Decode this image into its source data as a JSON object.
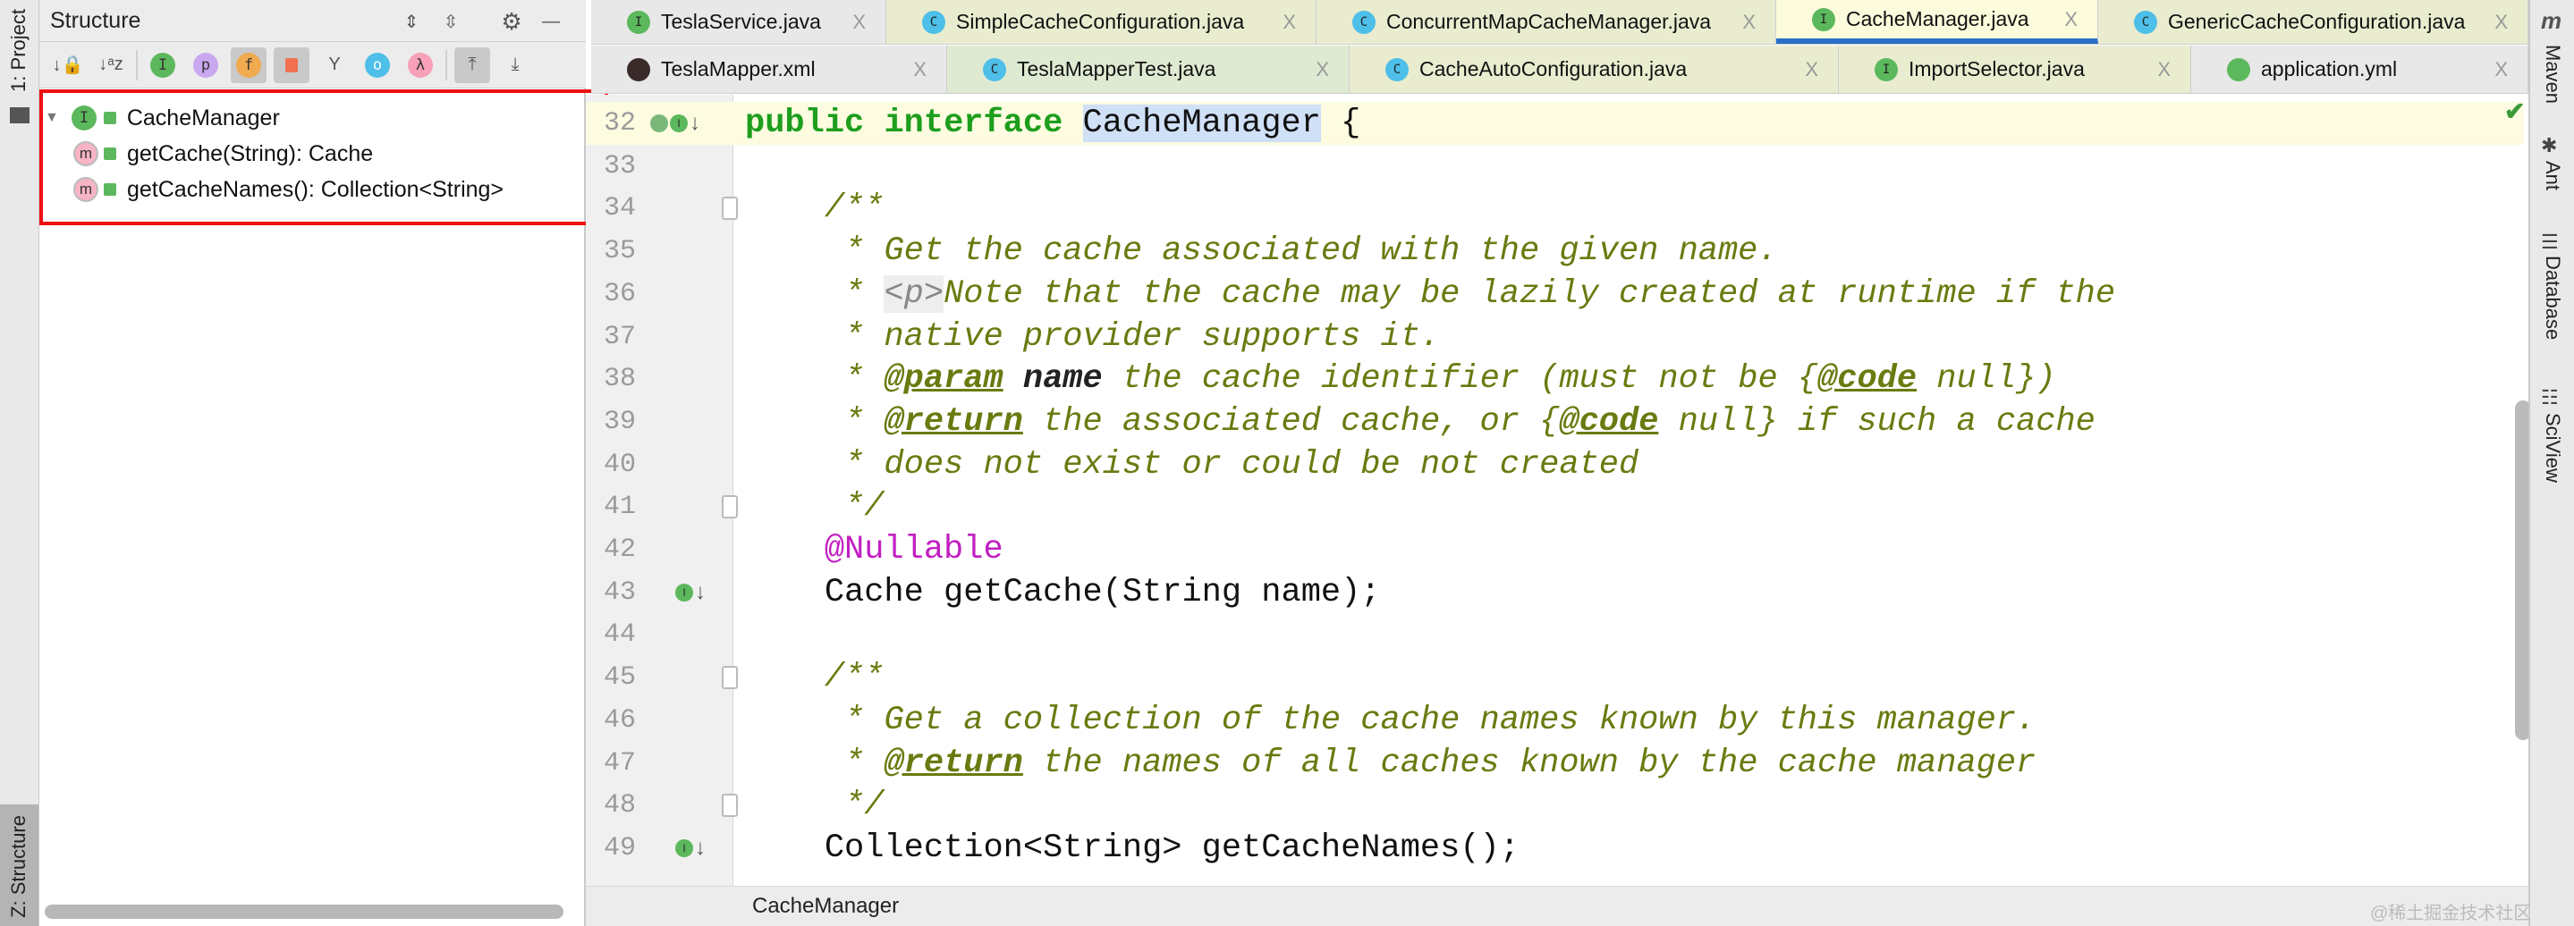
{
  "left_strip": {
    "project_label": "1: Project",
    "structure_label": "Z: Structure"
  },
  "right_strip": {
    "items": [
      "Maven",
      "Ant",
      "Database",
      "SciView"
    ]
  },
  "structure": {
    "title": "Structure",
    "tree": [
      {
        "label": "CacheManager",
        "icon": "I",
        "level": 0
      },
      {
        "label": "getCache(String): Cache",
        "icon": "m",
        "level": 1
      },
      {
        "label": "getCacheNames(): Collection<String>",
        "icon": "m",
        "level": 1
      }
    ]
  },
  "tabs": {
    "row1": [
      {
        "label": "TeslaService.java",
        "icon": "I",
        "bg": "#e8e8e8"
      },
      {
        "label": "SimpleCacheConfiguration.java",
        "icon": "C",
        "bg": "#e9eccf"
      },
      {
        "label": "ConcurrentMapCacheManager.java",
        "icon": "C",
        "bg": "#e9eccf"
      },
      {
        "label": "CacheManager.java",
        "icon": "I",
        "bg": "#fcfbdc",
        "active": true
      },
      {
        "label": "GenericCacheConfiguration.java",
        "icon": "C",
        "bg": "#e9eccf"
      }
    ],
    "row2": [
      {
        "label": "TeslaMapper.xml",
        "icon": "X",
        "bg": "#e8e8e8"
      },
      {
        "label": "TeslaMapperTest.java",
        "icon": "C",
        "bg": "#dfead2"
      },
      {
        "label": "CacheAutoConfiguration.java",
        "icon": "C",
        "bg": "#e9eccf"
      },
      {
        "label": "ImportSelector.java",
        "icon": "I",
        "bg": "#e9eccf"
      },
      {
        "label": "application.yml",
        "icon": "Y",
        "bg": "#e8e8e8"
      }
    ],
    "close_label": "X"
  },
  "code": [
    {
      "n": "32",
      "seg": [
        [
          "public",
          "k"
        ],
        [
          " ",
          ""
        ],
        [
          "interface",
          "k"
        ],
        [
          " ",
          ""
        ],
        [
          "CacheManager",
          "sel"
        ],
        [
          " {",
          ""
        ]
      ]
    },
    {
      "n": "33",
      "seg": []
    },
    {
      "n": "34",
      "seg": [
        [
          "    /**",
          "cm"
        ]
      ]
    },
    {
      "n": "35",
      "seg": [
        [
          "     * Get the cache associated with the given name.",
          "cm"
        ]
      ]
    },
    {
      "n": "36",
      "seg": [
        [
          "     * ",
          "cm"
        ],
        [
          "<p>",
          "ht"
        ],
        [
          "Note that the cache may be lazily created at runtime if the",
          "cm"
        ]
      ]
    },
    {
      "n": "37",
      "seg": [
        [
          "     * native provider supports it.",
          "cm"
        ]
      ]
    },
    {
      "n": "38",
      "seg": [
        [
          "     * ",
          "cm"
        ],
        [
          "@param",
          "tag"
        ],
        [
          " ",
          "cm"
        ],
        [
          "name",
          "pn"
        ],
        [
          " the cache identifier (must not be {",
          "cm"
        ],
        [
          "@code",
          "tag"
        ],
        [
          " null})",
          "cm"
        ]
      ]
    },
    {
      "n": "39",
      "seg": [
        [
          "     * ",
          "cm"
        ],
        [
          "@return",
          "tag"
        ],
        [
          " the associated cache, or {",
          "cm"
        ],
        [
          "@code",
          "tag"
        ],
        [
          " null} if such a cache",
          "cm"
        ]
      ]
    },
    {
      "n": "40",
      "seg": [
        [
          "     * does not exist or could be not created",
          "cm"
        ]
      ]
    },
    {
      "n": "41",
      "seg": [
        [
          "     */",
          "cm"
        ]
      ]
    },
    {
      "n": "42",
      "seg": [
        [
          "    @Nullable",
          "an"
        ]
      ]
    },
    {
      "n": "43",
      "seg": [
        [
          "    Cache getCache(String name);",
          ""
        ]
      ]
    },
    {
      "n": "44",
      "seg": []
    },
    {
      "n": "45",
      "seg": [
        [
          "    /**",
          "cm"
        ]
      ]
    },
    {
      "n": "46",
      "seg": [
        [
          "     * Get a collection of the cache names known by this manager.",
          "cm"
        ]
      ]
    },
    {
      "n": "47",
      "seg": [
        [
          "     * ",
          "cm"
        ],
        [
          "@return",
          "tag"
        ],
        [
          " the names of all caches known by the cache manager",
          "cm"
        ]
      ]
    },
    {
      "n": "48",
      "seg": [
        [
          "     */",
          "cm"
        ]
      ]
    },
    {
      "n": "49",
      "seg": [
        [
          "    Collection<String> getCacheNames();",
          ""
        ]
      ]
    }
  ],
  "breadcrumb": "CacheManager",
  "watermark": "@稀土掘金技术社区"
}
